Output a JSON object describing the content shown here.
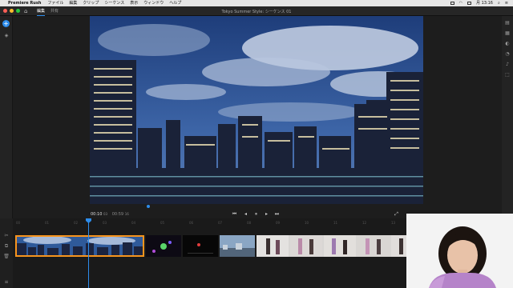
{
  "menubar": {
    "app_name": "Premiere Rush",
    "items": [
      "ファイル",
      "編集",
      "クリップ",
      "シーケンス",
      "表示",
      "ウィンドウ",
      "ヘルプ"
    ],
    "clock": "月 13:16"
  },
  "titlebar": {
    "tabs": [
      {
        "label": "編集",
        "active": true
      },
      {
        "label": "共有",
        "active": false
      }
    ],
    "document_title": "Tokyo Summer Style: シーケンス 01"
  },
  "transport": {
    "current_time": "00:10",
    "current_frames": "03",
    "duration": "00:59",
    "duration_frames": "16"
  },
  "ruler": {
    "ticks": [
      "00",
      "01",
      "02",
      "03",
      "04",
      "05",
      "06",
      "07",
      "08",
      "09",
      "10",
      "11",
      "12",
      "13",
      "14",
      "15"
    ]
  },
  "colors": {
    "accent": "#2d8ceb",
    "selection": "#f7941d",
    "app_bg": "#1d1d1d"
  },
  "icons": {
    "add": "plus-circle-icon",
    "home": "home-icon"
  }
}
